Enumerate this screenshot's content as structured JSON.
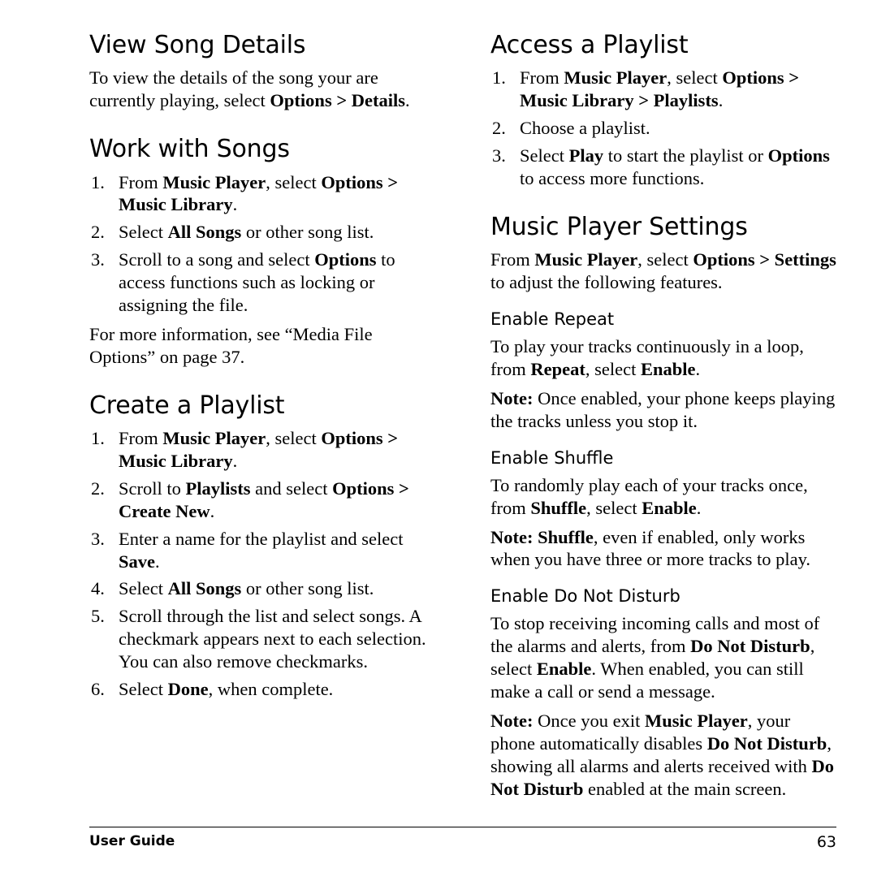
{
  "page": {
    "footer_left": "User Guide",
    "page_number": "63"
  },
  "left_column": {
    "section1": {
      "heading": "View Song Details",
      "body_plain_1": "To view the details of the song your are currently playing, select ",
      "body_bold_1": "Options > Details",
      "body_plain_2": "."
    },
    "section2": {
      "heading": "Work with Songs",
      "steps": [
        {
          "plain_1": "From ",
          "bold_1": "Music Player",
          "plain_2": ", select ",
          "bold_2": "Options > Music Library",
          "plain_3": "."
        },
        {
          "plain_1": "Select ",
          "bold_1": "All Songs",
          "plain_2": " or other song list.",
          "bold_2": "",
          "plain_3": ""
        },
        {
          "plain_1": "Scroll to a song and select ",
          "bold_1": "Options",
          "plain_2": " to access functions such as locking or assigning the file.",
          "bold_2": "",
          "plain_3": ""
        }
      ],
      "note": "For more information, see “Media File Options” on page 37."
    },
    "section3": {
      "heading": "Create a Playlist",
      "steps": [
        {
          "plain_1": "From ",
          "bold_1": "Music Player",
          "plain_2": ", select ",
          "bold_2": "Options > Music Library",
          "plain_3": "."
        },
        {
          "plain_1": "Scroll to ",
          "bold_1": "Playlists",
          "plain_2": " and select ",
          "bold_2": "Options > Create New",
          "plain_3": "."
        },
        {
          "plain_1": "Enter a name for the playlist and select ",
          "bold_1": "Save",
          "plain_2": ".",
          "bold_2": "",
          "plain_3": ""
        },
        {
          "plain_1": "Select ",
          "bold_1": "All Songs",
          "plain_2": " or other song list.",
          "bold_2": "",
          "plain_3": ""
        },
        {
          "plain_1": "Scroll through the list and select songs. A checkmark appears next to each selection. You can also remove checkmarks.",
          "bold_1": "",
          "plain_2": "",
          "bold_2": "",
          "plain_3": ""
        },
        {
          "plain_1": "Select ",
          "bold_1": "Done",
          "plain_2": ", when complete.",
          "bold_2": "",
          "plain_3": ""
        }
      ]
    }
  },
  "right_column": {
    "section1": {
      "heading": "Access a Playlist",
      "steps": [
        {
          "plain_1": "From ",
          "bold_1": "Music Player",
          "plain_2": ", select ",
          "bold_2": "Options > Music Library > Playlists",
          "plain_3": "."
        },
        {
          "plain_1": "Choose a playlist.",
          "bold_1": "",
          "plain_2": "",
          "bold_2": "",
          "plain_3": ""
        },
        {
          "plain_1": "Select ",
          "bold_1": "Play",
          "plain_2": " to start the playlist or ",
          "bold_2": "Options",
          "plain_3": " to access more functions."
        }
      ]
    },
    "section2": {
      "heading": "Music Player Settings",
      "intro_plain_1": "From ",
      "intro_bold_1": "Music Player",
      "intro_plain_2": ", select ",
      "intro_bold_2": "Options > Settings",
      "intro_plain_3": " to adjust the following features.",
      "sub1": {
        "heading": "Enable Repeat",
        "p1_plain_1": "To play your tracks continuously in a loop, from ",
        "p1_bold_1": "Repeat",
        "p1_plain_2": ", select ",
        "p1_bold_2": "Enable",
        "p1_plain_3": ".",
        "p2_bold_1": "Note:",
        "p2_plain_1": " Once enabled, your phone keeps playing the tracks unless you stop it."
      },
      "sub2": {
        "heading": "Enable Shuffle",
        "p1_plain_1": "To randomly play each of your tracks once, from ",
        "p1_bold_1": "Shuffle",
        "p1_plain_2": ", select ",
        "p1_bold_2": "Enable",
        "p1_plain_3": ".",
        "p2_bold_1": "Note: Shuffle",
        "p2_plain_1": ", even if enabled, only works when you have three or more tracks to play."
      },
      "sub3": {
        "heading": "Enable Do Not Disturb",
        "p1_plain_1": "To stop receiving incoming calls and most of the alarms and alerts, from ",
        "p1_bold_1": "Do Not Disturb",
        "p1_plain_2": ", select ",
        "p1_bold_2": "Enable",
        "p1_plain_3": ". When enabled, you can still make a call or send a message.",
        "p2_bold_1": "Note:",
        "p2_plain_1": " Once you exit ",
        "p2_bold_2": "Music Player",
        "p2_plain_2": ", your phone automatically disables ",
        "p2_bold_3": "Do Not Disturb",
        "p2_plain_3": ", showing all alarms and alerts received with ",
        "p2_bold_4": "Do Not Disturb",
        "p2_plain_4": " enabled at the main screen."
      }
    }
  }
}
